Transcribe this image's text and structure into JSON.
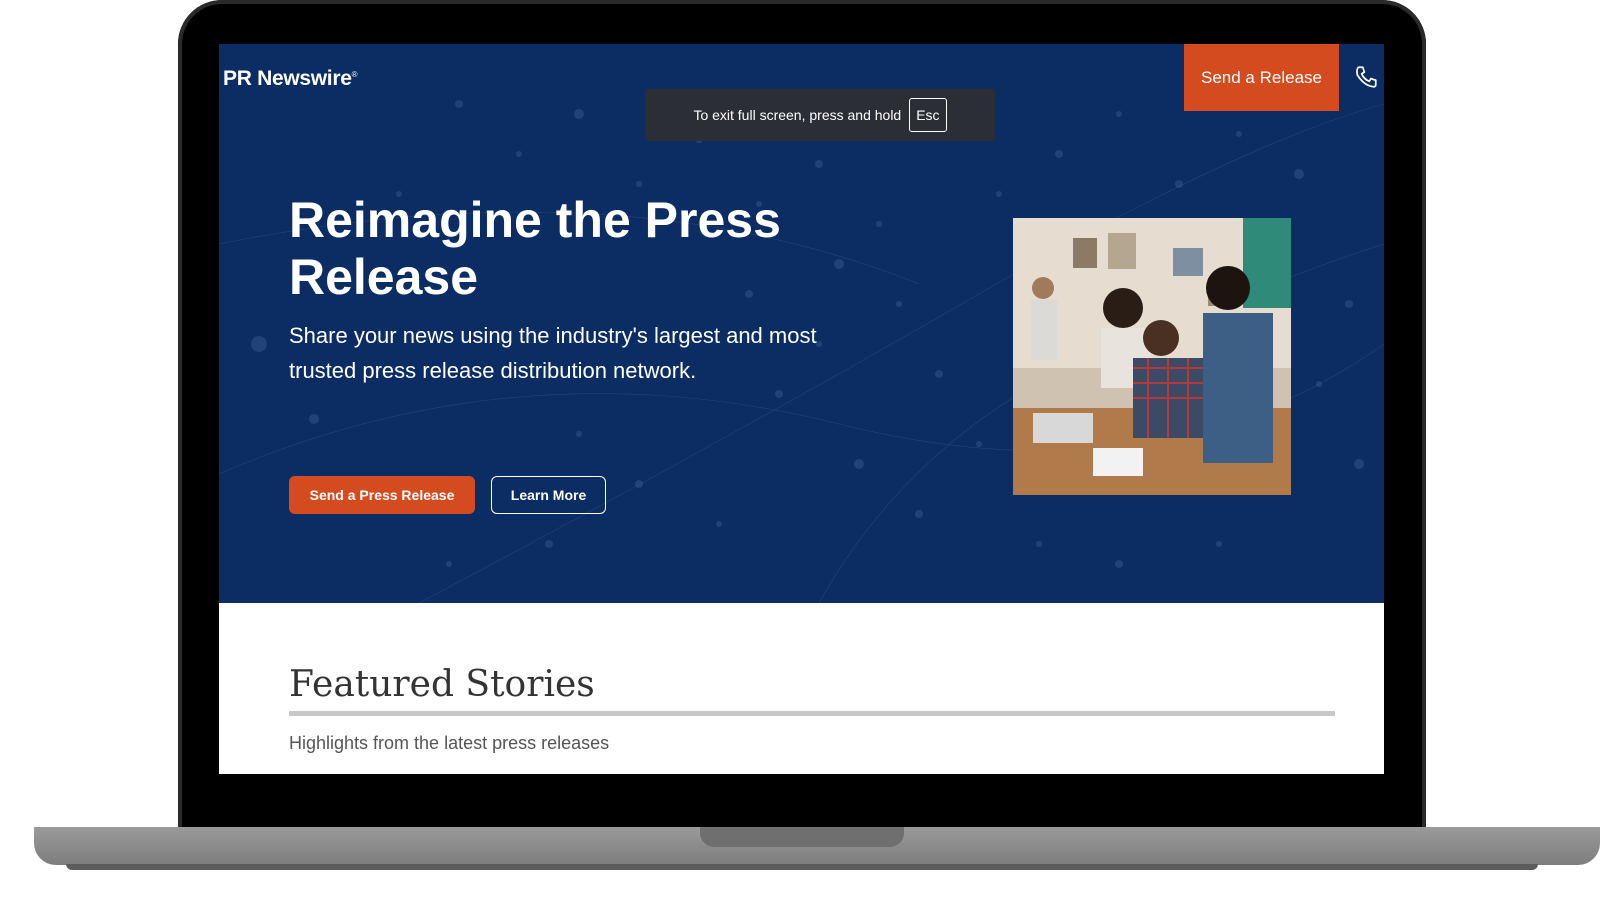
{
  "header": {
    "logo_text": "PR Newswire",
    "logo_mark": "®",
    "send_release_label": "Send a Release",
    "phone_icon": "phone-icon"
  },
  "fullscreen_notice": {
    "text": "To exit full screen, press and hold",
    "key": "Esc"
  },
  "hero": {
    "title": "Reimagine the Press Release",
    "subtitle": "Share your news using the industry's largest and most trusted press release distribution network.",
    "primary_button": "Send a Press Release",
    "secondary_button": "Learn More",
    "photo": "team-working-photo"
  },
  "featured": {
    "title": "Featured Stories",
    "subtitle": "Highlights from the latest press releases"
  },
  "colors": {
    "hero_bg": "#0b2d64",
    "accent": "#d54b20",
    "banner_bg": "#2b2e35"
  }
}
